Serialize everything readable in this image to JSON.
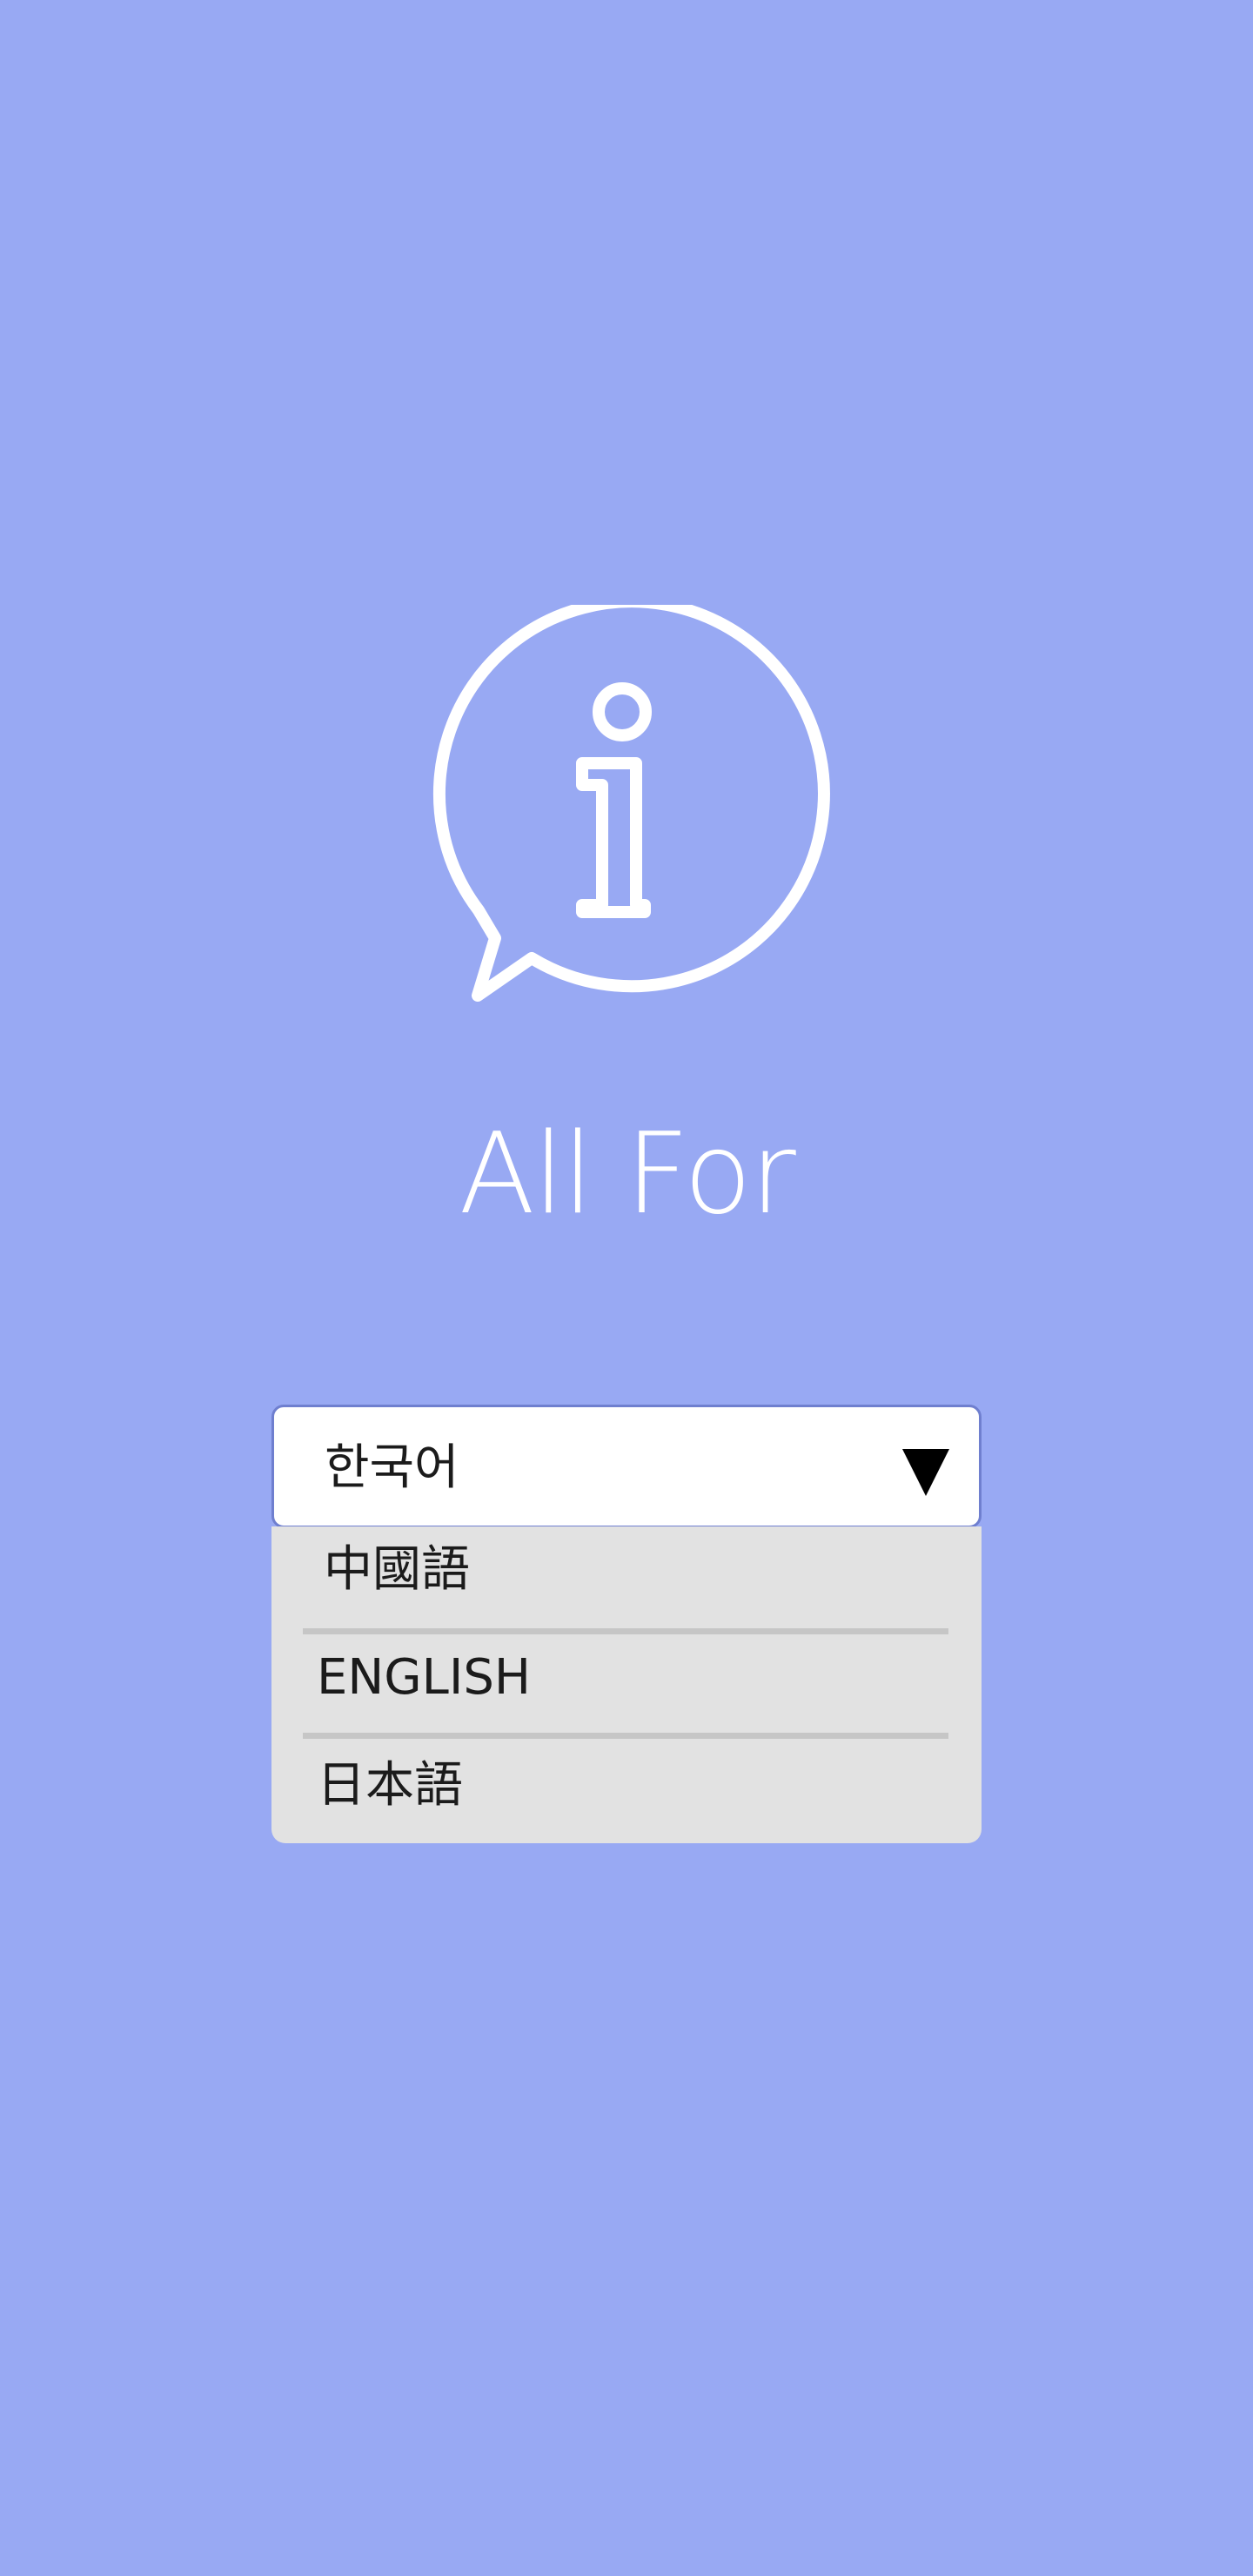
{
  "app": {
    "title": "All For"
  },
  "icons": {
    "logo": "info-speech-bubble-icon",
    "dropdown": "caret-down-icon"
  },
  "language_select": {
    "selected": "한국어",
    "options": [
      {
        "label": "中國語"
      },
      {
        "label": "ENGLISH"
      },
      {
        "label": "日本語"
      }
    ]
  },
  "colors": {
    "background": "#98a9f3",
    "select_border": "#6f7fcf",
    "dropdown_list": "#e2e2e2",
    "divider": "#c6c6c6"
  }
}
